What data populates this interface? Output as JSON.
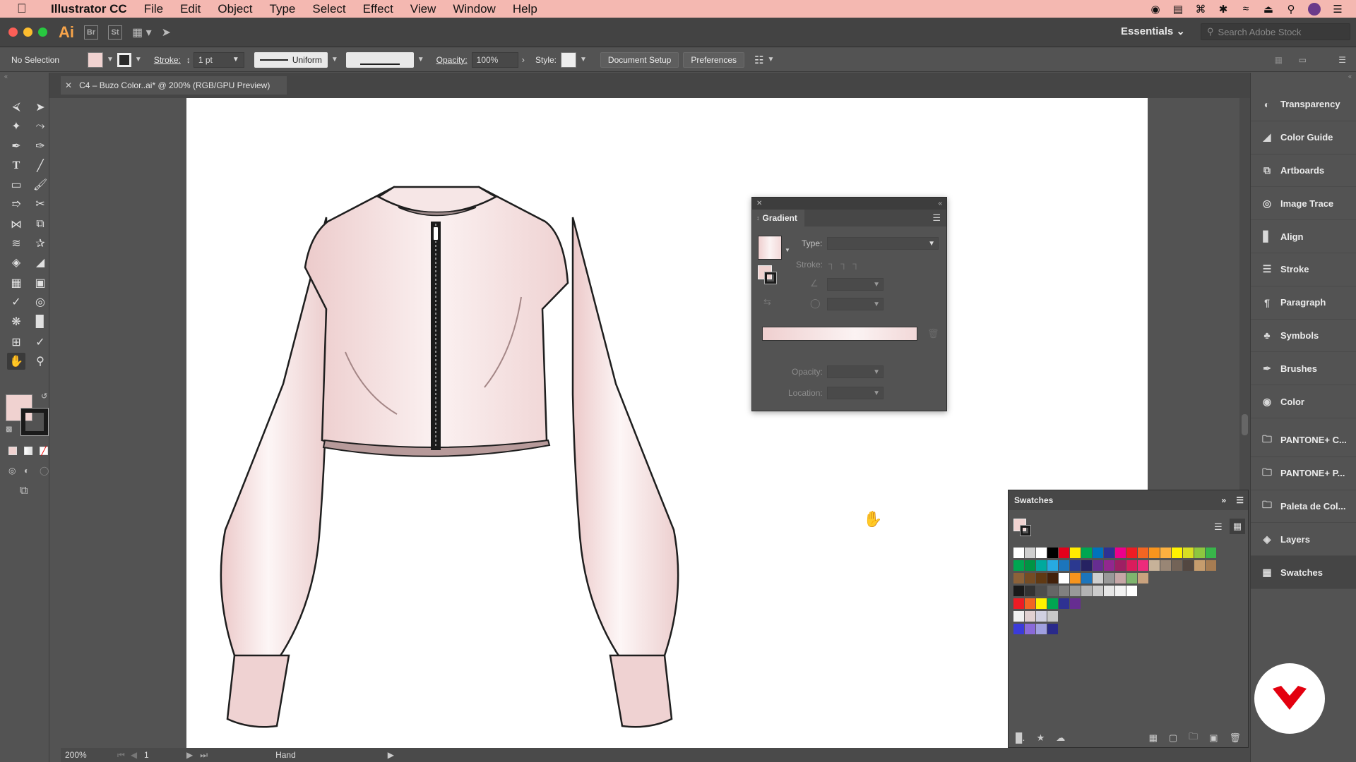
{
  "menubar": {
    "app": "Illustrator CC",
    "menus": [
      "File",
      "Edit",
      "Object",
      "Type",
      "Select",
      "Effect",
      "View",
      "Window",
      "Help"
    ]
  },
  "header": {
    "logo": "Ai",
    "bridge": "Br",
    "stock": "St",
    "workspace": "Essentials",
    "stock_search_placeholder": "Search Adobe Stock"
  },
  "control": {
    "selection": "No Selection",
    "stroke_label": "Stroke:",
    "stroke_value": "1 pt",
    "profile": "Uniform",
    "opacity_label": "Opacity:",
    "opacity_value": "100%",
    "style_label": "Style:",
    "doc_setup": "Document Setup",
    "preferences": "Preferences"
  },
  "document": {
    "tab_title": "C4 – Buzo Color..ai* @ 200% (RGB/GPU Preview)"
  },
  "gradient_panel": {
    "title": "Gradient",
    "type_label": "Type:",
    "stroke_label": "Stroke:",
    "opacity_label": "Opacity:",
    "location_label": "Location:"
  },
  "swatches_panel": {
    "title": "Swatches"
  },
  "dock": {
    "items": [
      {
        "label": "Transparency",
        "icon": "transparency-icon"
      },
      {
        "label": "Color Guide",
        "icon": "color-guide-icon"
      },
      {
        "label": "Artboards",
        "icon": "artboards-icon"
      },
      {
        "label": "Image Trace",
        "icon": "image-trace-icon"
      },
      {
        "label": "Align",
        "icon": "align-icon"
      },
      {
        "label": "Stroke",
        "icon": "stroke-icon"
      },
      {
        "label": "Paragraph",
        "icon": "paragraph-icon"
      },
      {
        "label": "Symbols",
        "icon": "symbols-icon"
      },
      {
        "label": "Brushes",
        "icon": "brushes-icon"
      },
      {
        "label": "Color",
        "icon": "color-icon"
      },
      {
        "label": "PANTONE+ C...",
        "icon": "folder-icon"
      },
      {
        "label": "PANTONE+ P...",
        "icon": "folder-icon"
      },
      {
        "label": "Paleta de Col...",
        "icon": "folder-icon"
      },
      {
        "label": "Layers",
        "icon": "layers-icon"
      },
      {
        "label": "Swatches",
        "icon": "swatches-icon"
      }
    ]
  },
  "status": {
    "zoom": "200%",
    "artboard": "1",
    "tool": "Hand"
  },
  "colors": {
    "fill": "#f0d2d0",
    "menubar": "#f4b8b1",
    "accent": "#e3000f"
  }
}
